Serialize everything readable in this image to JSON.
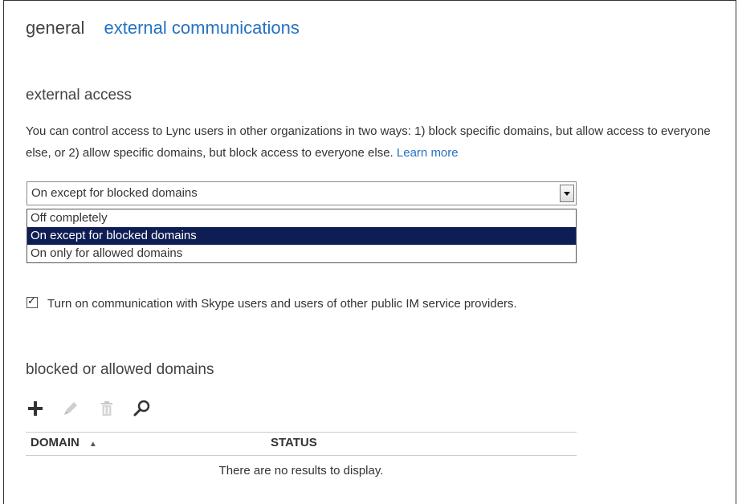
{
  "tabs": {
    "general": "general",
    "external": "external communications"
  },
  "external_access": {
    "title": "external access",
    "description": "You can control access to Lync users in other organizations in two ways: 1) block specific domains, but allow access to everyone else, or 2) allow specific domains, but block access to everyone else.",
    "learn_more": "Learn more",
    "selected_value": "On except for blocked domains",
    "options": [
      "Off completely",
      "On except for blocked domains",
      "On only for allowed domains"
    ],
    "skype_checkbox_label": "Turn on communication with Skype users and users of other public IM service providers.",
    "skype_checked": true
  },
  "domains": {
    "title": "blocked or allowed domains",
    "toolbar_icons": [
      "add-icon",
      "edit-icon",
      "delete-icon",
      "search-icon"
    ],
    "columns": {
      "domain": "DOMAIN",
      "status": "STATUS"
    },
    "sort_indicator": "▲",
    "empty_message": "There are no results to display."
  },
  "colors": {
    "accent": "#2672c2",
    "selected_option_bg": "#0e1e54"
  }
}
